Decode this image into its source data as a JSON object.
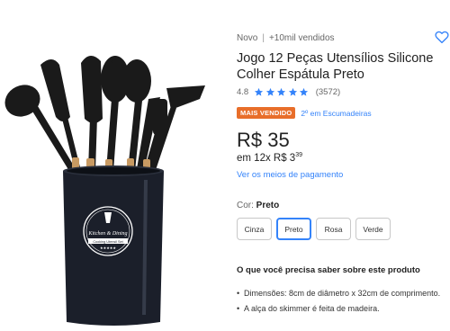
{
  "product": {
    "condition": "Novo",
    "separator": "|",
    "sold": "+10mil vendidos",
    "title": "Jogo 12 Peças Utensílios Silicone Colher Espátula Preto",
    "favorite_icon": "heart-outline-icon"
  },
  "rating": {
    "score": "4.8",
    "count": "(3572)",
    "stars_filled": 5,
    "star_color": "#3483fa"
  },
  "badge": {
    "label": "MAIS VENDIDO",
    "rank": "2º em Escumadeiras",
    "color": "#e86e2a"
  },
  "price": {
    "main": "R$ 35",
    "installment_prefix": "em 12x R$ 3",
    "installment_cents": "39",
    "payment_link": "Ver os meios de pagamento"
  },
  "color": {
    "label": "Cor: ",
    "selected": "Preto",
    "options": [
      "Cinza",
      "Preto",
      "Rosa",
      "Verde"
    ],
    "selected_index": 1
  },
  "features": {
    "title": "O que você precisa saber sobre este produto",
    "items": [
      "Dimensões: 8cm de diâmetro x 32cm de comprimento.",
      "A alça do skimmer é feita de madeira."
    ]
  },
  "image": {
    "logo_line1": "Kitchen & Dining",
    "logo_line2": "Cooking Utensil Set"
  },
  "accent": "#3483fa"
}
